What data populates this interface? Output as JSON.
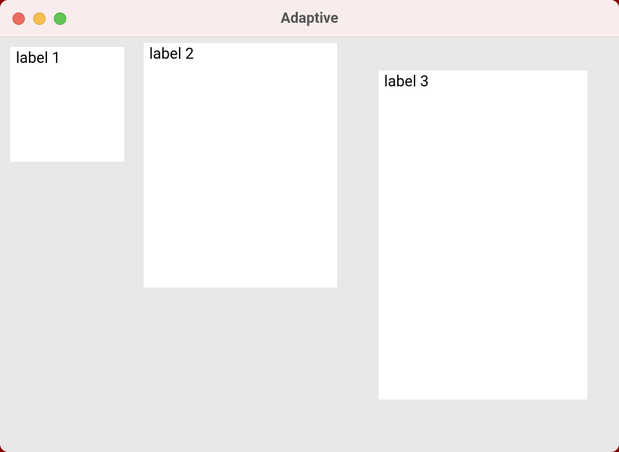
{
  "window": {
    "title": "Adaptive"
  },
  "panels": {
    "panel1": {
      "label": "label 1"
    },
    "panel2": {
      "label": "label 2"
    },
    "panel3": {
      "label": "label 3"
    }
  }
}
